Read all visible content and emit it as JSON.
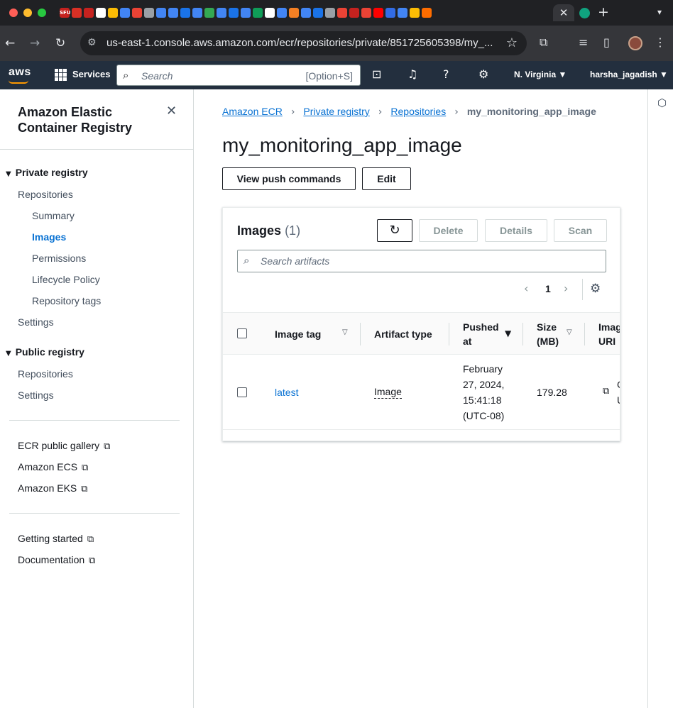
{
  "browser": {
    "close_tab_glyph": "✕",
    "new_tab_glyph": "+",
    "tab_menu_glyph": "▾",
    "back_glyph": "←",
    "forward_glyph": "→",
    "reload_glyph": "↻",
    "url": "us-east-1.console.aws.amazon.com/ecr/repositories/private/851725605398/my_...",
    "star_glyph": "☆",
    "favicon_colors": [
      "#c5221f",
      "#d93025",
      "#c5221f",
      "#ffffff",
      "#fbbc04",
      "#4285f4",
      "#ea4335",
      "#9aa0a6",
      "#4285f4",
      "#4285f4",
      "#1a73e8",
      "#4285f4",
      "#34a853",
      "#4285f4",
      "#1a73e8",
      "#4285f4",
      "#0f9d58",
      "#ffffff",
      "#4285f4",
      "#f48024",
      "#4285f4",
      "#1a73e8",
      "#9aa0a6",
      "#ea4335",
      "#c5221f",
      "#ea4335",
      "#ff0000",
      "#326ce5",
      "#4285f4",
      "#fbbc04",
      "#ff6d00"
    ],
    "favicon_labels": [
      "SFU"
    ]
  },
  "aws_nav": {
    "logo": "aws",
    "services": "Services",
    "search_placeholder": "Search",
    "search_shortcut": "[Option+S]",
    "region": "N. Virginia ▼",
    "user": "harsha_jagadish ▼"
  },
  "sidebar": {
    "title": "Amazon Elastic Container Registry",
    "close_glyph": "✕",
    "private_registry": "Private registry",
    "private_items": {
      "repositories": "Repositories",
      "summary": "Summary",
      "images": "Images",
      "permissions": "Permissions",
      "lifecycle": "Lifecycle Policy",
      "repo_tags": "Repository tags",
      "settings": "Settings"
    },
    "public_registry": "Public registry",
    "public_items": {
      "repositories": "Repositories",
      "settings": "Settings"
    },
    "links": {
      "gallery": "ECR public gallery",
      "ecs": "Amazon ECS",
      "eks": "Amazon EKS",
      "getting_started": "Getting started",
      "documentation": "Documentation"
    },
    "external_glyph": "⧉"
  },
  "breadcrumbs": {
    "items": [
      "Amazon ECR",
      "Private registry",
      "Repositories"
    ],
    "current": "my_monitoring_app_image",
    "separator": "›"
  },
  "page": {
    "title": "my_monitoring_app_image",
    "view_push": "View push commands",
    "edit": "Edit"
  },
  "images_panel": {
    "title": "Images",
    "count": "(1)",
    "refresh_glyph": "↻",
    "delete": "Delete",
    "details": "Details",
    "scan": "Scan",
    "search_placeholder": "Search artifacts",
    "page_number": "1",
    "prev_glyph": "‹",
    "next_glyph": "›",
    "gear_glyph": "⚙",
    "columns": {
      "image_tag": "Image tag",
      "artifact_type": "Artifact type",
      "pushed_at_1": "Pushed",
      "pushed_at_2": "at",
      "size_1": "Size",
      "size_2": "(MB)",
      "uri_1": "Image",
      "uri_2": "URI"
    },
    "rows": [
      {
        "image_tag": "latest",
        "artifact_type": "Image",
        "pushed_line1": "February",
        "pushed_line2": "27, 2024,",
        "pushed_line3": "15:41:18",
        "pushed_line4": "(UTC-08)",
        "size": "179.28",
        "uri_line1": "C",
        "uri_line2": "U"
      }
    ]
  },
  "colors": {
    "aws_nav_bg": "#232f3e",
    "link_blue": "#0972d3",
    "aws_orange": "#ff9900"
  }
}
